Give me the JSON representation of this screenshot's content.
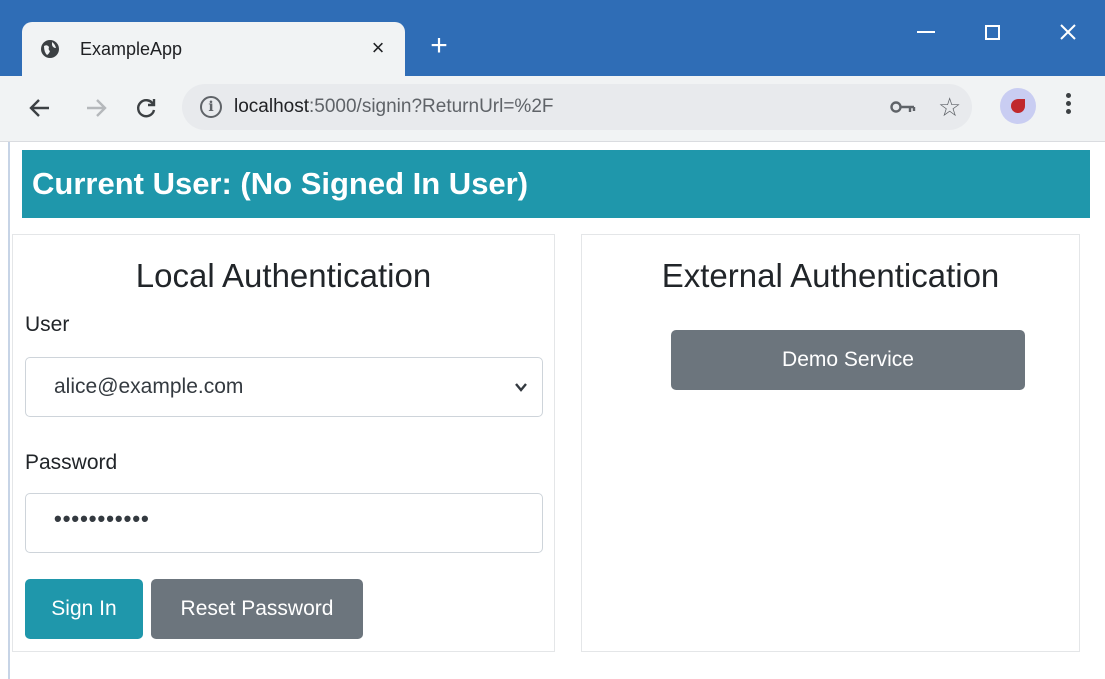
{
  "browser": {
    "tab_title": "ExampleApp",
    "tab_close": "×",
    "new_tab": "+",
    "url_host": "localhost",
    "url_rest": ":5000/signin?ReturnUrl=%2F",
    "icons": {
      "tab": "globe-icon",
      "back": "arrow-left-icon",
      "forward": "arrow-right-icon",
      "reload": "reload-icon",
      "info": "info-icon",
      "key": "key-icon",
      "star": "star-icon",
      "menu": "more-vert-icon"
    }
  },
  "page": {
    "banner": "Current User: (No Signed In User)",
    "local": {
      "title": "Local Authentication",
      "user_label": "User",
      "user_value": "alice@example.com",
      "password_label": "Password",
      "password_value": "•••••••••••",
      "signin_label": "Sign In",
      "reset_label": "Reset Password"
    },
    "external": {
      "title": "External Authentication",
      "demo_label": "Demo Service"
    }
  },
  "colors": {
    "titlebar": "#2f6db6",
    "banner": "#1f97ab",
    "primary_button": "#1f97ab",
    "secondary_button": "#6c757d"
  }
}
